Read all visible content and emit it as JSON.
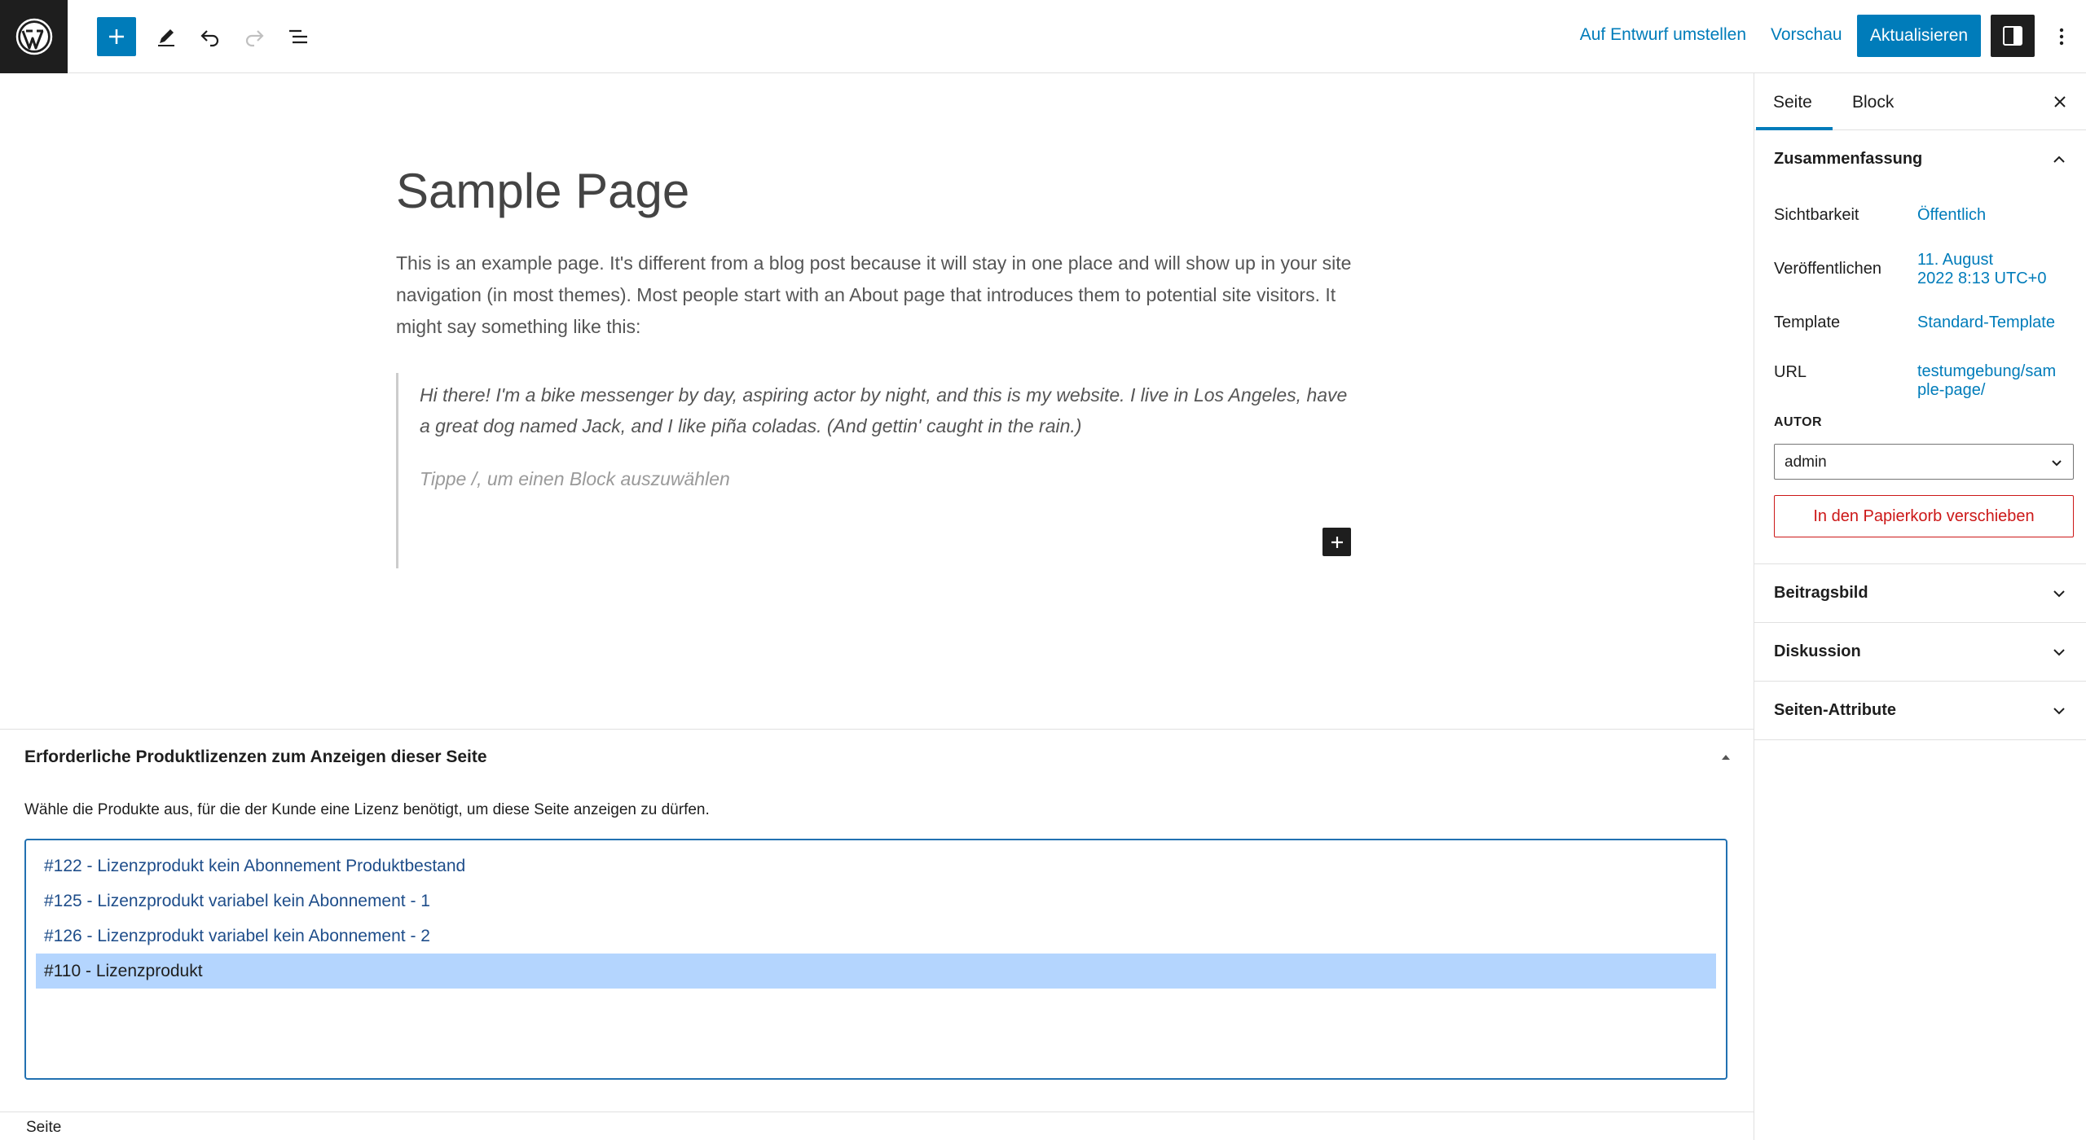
{
  "topbar": {
    "draft_label": "Auf Entwurf umstellen",
    "preview_label": "Vorschau",
    "update_label": "Aktualisieren"
  },
  "editor": {
    "title": "Sample Page",
    "paragraph": "This is an example page. It's different from a blog post because it will stay in one place and will show up in your site navigation (in most themes). Most people start with an About page that introduces them to potential site visitors. It might say something like this:",
    "quote": "Hi there! I'm a bike messenger by day, aspiring actor by night, and this is my website. I live in Los Angeles, have a great dog named Jack, and I like piña coladas. (And gettin' caught in the rain.)",
    "block_placeholder": "Tippe /, um einen Block auszuwählen"
  },
  "metabox": {
    "title": "Erforderliche Produktlizenzen zum Anzeigen dieser Seite",
    "description": "Wähle die Produkte aus, für die der Kunde eine Lizenz benötigt, um diese Seite anzeigen zu dürfen.",
    "options": [
      "#122 - Lizenzprodukt kein Abonnement Produktbestand",
      "#125 - Lizenzprodukt variabel kein Abonnement - 1",
      "#126 - Lizenzprodukt variabel kein Abonnement - 2",
      "#110 - Lizenzprodukt"
    ],
    "selected_index": 3
  },
  "statusbar": {
    "label": "Seite"
  },
  "sidebar": {
    "tabs": [
      "Seite",
      "Block"
    ],
    "active_tab": "Seite",
    "summary": {
      "title": "Zusammenfassung",
      "visibility_label": "Sichtbarkeit",
      "visibility_value": "Öffentlich",
      "publish_label": "Veröffentlichen",
      "publish_value_line1": "11. August",
      "publish_value_line2": "2022 8:13 UTC+0",
      "template_label": "Template",
      "template_value": "Standard-Template",
      "url_label": "URL",
      "url_value_line1": "testumgebung/sam",
      "url_value_line2": "ple-page/",
      "author_label": "AUTOR",
      "author_value": "admin",
      "trash_label": "In den Papierkorb verschieben"
    },
    "panels": [
      "Beitragsbild",
      "Diskussion",
      "Seiten-Attribute"
    ]
  },
  "colors": {
    "accent": "#007cba",
    "danger": "#cc1818",
    "selection": "#b4d5fe"
  }
}
